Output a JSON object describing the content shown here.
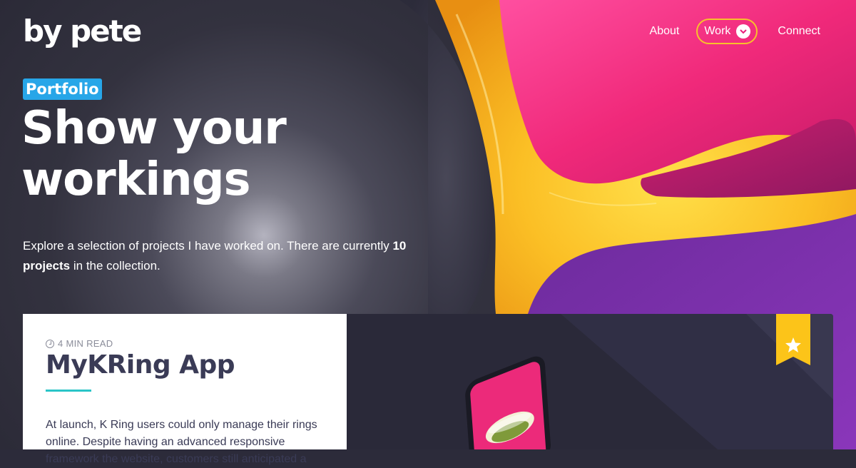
{
  "logo": {
    "text": "by pete"
  },
  "nav": {
    "about": "About",
    "work": "Work",
    "connect": "Connect"
  },
  "hero": {
    "badge": "Portfolio",
    "title_line1": "Show your",
    "title_line2": "workings",
    "intro_prefix": "Explore a selection of projects I have worked on. There are currently ",
    "intro_bold": "10 projects",
    "intro_suffix": " in the collection."
  },
  "featured": {
    "read_time": "4 MIN READ",
    "title": "MyKRing App",
    "excerpt": "At launch, K Ring users could only manage their rings online. Despite having an advanced responsive framework the website, customers still anticipated a",
    "featured_icon": "star-icon"
  },
  "colors": {
    "accent_yellow": "#f8c12b",
    "accent_pink": "#ea2a7c",
    "badge_blue": "#27a6e8",
    "accent_teal": "#2ac5c7",
    "dark_bg": "#2c2b3a"
  }
}
